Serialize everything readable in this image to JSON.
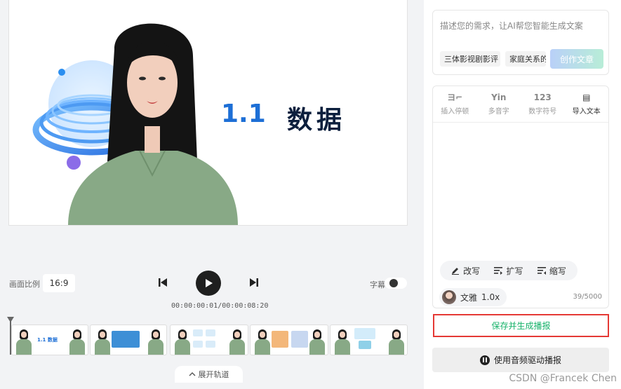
{
  "canvas": {
    "slide_number": "1.1",
    "slide_heading": "数据"
  },
  "controls": {
    "ratio_label": "画面比例",
    "ratio_value": "16:9",
    "subtitle_label": "字幕",
    "subtitle_on": true,
    "timecode": "00:00:00:01/00:00:08:20"
  },
  "timeline": {
    "expand_label": "展开轨道",
    "clip_caption": "1.1 数据"
  },
  "ai_writer": {
    "placeholder": "描述您的需求，让AI帮您智能生成文案",
    "chips": [
      "三体影视剧影评",
      "家庭关系的"
    ],
    "create_label": "创作文章"
  },
  "tools": [
    {
      "icon": "insert-pause-icon",
      "glyph": "ヨ⌐",
      "label": "插入停顿",
      "active": false
    },
    {
      "icon": "polyphone-icon",
      "glyph": "Yin",
      "label": "多音字",
      "active": false
    },
    {
      "icon": "number-symbol-icon",
      "glyph": "123",
      "label": "数字符号",
      "active": false
    },
    {
      "icon": "import-text-icon",
      "glyph": "▤",
      "label": "导入文本",
      "active": true
    }
  ],
  "rewrite": {
    "rewrite_label": "改写",
    "expand_label": "扩写",
    "shorten_label": "缩写"
  },
  "voice": {
    "name": "文雅",
    "speed": "1.0x",
    "char_count": "39/5000"
  },
  "actions": {
    "save_label": "保存并生成播报",
    "audio_label": "使用音频驱动播报"
  },
  "watermark": "CSDN @Francek Chen",
  "colors": {
    "accent_green": "#17b26a",
    "highlight_red": "#e53935",
    "title_blue": "#1d6fd6"
  }
}
